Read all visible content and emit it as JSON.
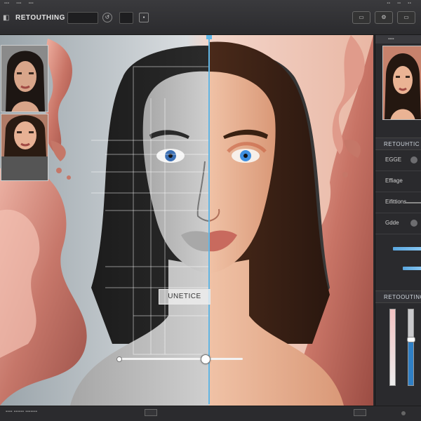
{
  "app": {
    "title": "RETOUTHING"
  },
  "canvas": {
    "before_label": "UNETICE",
    "comparison_slider": 0.7
  },
  "panel": {
    "section_title": "RETOUTCHING",
    "options": [
      {
        "label": "RETOUHTIC"
      },
      {
        "label": "EGGE"
      },
      {
        "label": "Effiage"
      },
      {
        "label": "Eifittions"
      },
      {
        "label": "Gdde"
      }
    ],
    "sliders": [
      {
        "level": 0.45
      },
      {
        "level": 0.3
      }
    ],
    "bottom_title": "RETOOUTING",
    "vertical_sliders": [
      {
        "level": 0.0
      },
      {
        "level": 0.6
      }
    ]
  },
  "colors": {
    "accent": "#5fb6e6",
    "skin_swirl": "#d98a7c",
    "slider_fill": "#2f7fc5"
  },
  "icons": [
    "app-icon",
    "undo-icon",
    "redo-icon",
    "settings-icon"
  ]
}
